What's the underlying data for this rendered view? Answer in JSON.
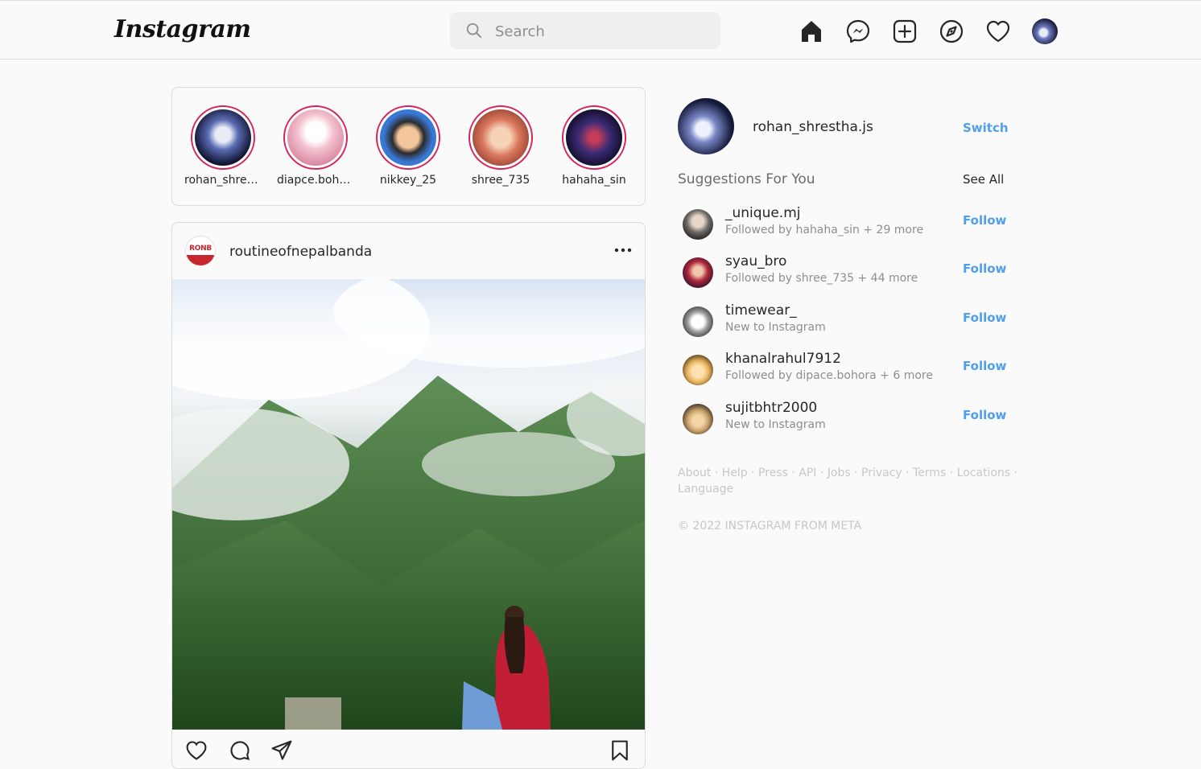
{
  "header": {
    "logo": "Instagram",
    "search_placeholder": "Search"
  },
  "stories": [
    {
      "username": "rohan_shrestha.js",
      "colors": [
        "#e8ecf7",
        "#5a6bb3",
        "#121633"
      ]
    },
    {
      "username": "diapce.bohora",
      "colors": [
        "#ffffff",
        "#f3c2cf",
        "#d98aa0"
      ]
    },
    {
      "username": "nikkey_25",
      "colors": [
        "#f2c59b",
        "#2b2b2b",
        "#3a78d6"
      ]
    },
    {
      "username": "shree_735",
      "colors": [
        "#f6d3b7",
        "#d9785e",
        "#a14a39"
      ]
    },
    {
      "username": "hahaha_sin",
      "colors": [
        "#c43c5a",
        "#3a2b74",
        "#150f2e"
      ]
    }
  ],
  "post": {
    "avatar_text": "RONB",
    "username": "routineofnepalbanda"
  },
  "profile": {
    "username": "rohan_shrestha.js",
    "switch_label": "Switch"
  },
  "suggestions": {
    "title": "Suggestions For You",
    "see_all": "See All",
    "items": [
      {
        "username": "_unique.mj",
        "subtitle": "Followed by hahaha_sin + 29 more",
        "follow_label": "Follow",
        "colors": [
          "#e7d6c9",
          "#6f6a67",
          "#2d2d2d"
        ]
      },
      {
        "username": "syau_bro",
        "subtitle": "Followed by shree_735 + 44 more",
        "follow_label": "Follow",
        "colors": [
          "#f0c8b0",
          "#b0263a",
          "#3a1630"
        ]
      },
      {
        "username": "timewear_",
        "subtitle": "New to Instagram",
        "follow_label": "Follow",
        "colors": [
          "#ffffff",
          "#9a9a9a",
          "#4a4a4a"
        ]
      },
      {
        "username": "khanalrahul7912",
        "subtitle": "Followed by dipace.bohora + 6 more",
        "follow_label": "Follow",
        "colors": [
          "#ffe0b0",
          "#e3b35a",
          "#6b4a2a"
        ]
      },
      {
        "username": "sujitbhtr2000",
        "subtitle": "New to Instagram",
        "follow_label": "Follow",
        "colors": [
          "#f5d5a8",
          "#caa36c",
          "#4a3a2a"
        ]
      }
    ]
  },
  "footer": {
    "links": [
      "About",
      "Help",
      "Press",
      "API",
      "Jobs",
      "Privacy",
      "Terms",
      "Locations",
      "Language"
    ],
    "copyright": "© 2022 INSTAGRAM FROM META"
  }
}
